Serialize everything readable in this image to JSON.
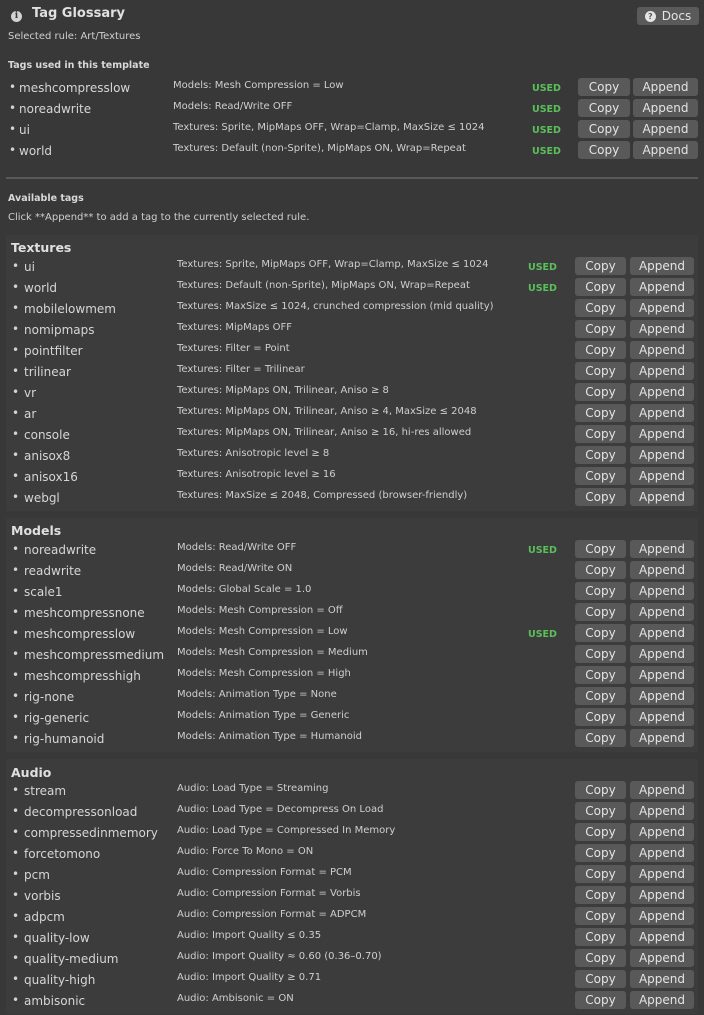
{
  "header": {
    "title": "Tag Glossary",
    "docs_label": "Docs",
    "selected_rule": "Selected rule: Art/Textures"
  },
  "template": {
    "heading": "Tags used in this template",
    "tags": [
      {
        "name": "meshcompresslow",
        "desc": "Models: Mesh Compression = Low",
        "used": "USED"
      },
      {
        "name": "noreadwrite",
        "desc": "Models: Read/Write OFF",
        "used": "USED"
      },
      {
        "name": "ui",
        "desc": "Textures: Sprite, MipMaps OFF, Wrap=Clamp, MaxSize ≤ 1024",
        "used": "USED"
      },
      {
        "name": "world",
        "desc": "Textures: Default (non-Sprite), MipMaps ON, Wrap=Repeat",
        "used": "USED"
      }
    ]
  },
  "available": {
    "heading": "Available tags",
    "hint": "Click **Append** to add a tag to the currently selected rule."
  },
  "buttons": {
    "copy": "Copy",
    "append": "Append"
  },
  "groups": [
    {
      "title": "Textures",
      "tags": [
        {
          "name": "ui",
          "desc": "Textures: Sprite, MipMaps OFF, Wrap=Clamp, MaxSize ≤ 1024",
          "used": "USED"
        },
        {
          "name": "world",
          "desc": "Textures: Default (non-Sprite), MipMaps ON, Wrap=Repeat",
          "used": "USED"
        },
        {
          "name": "mobilelowmem",
          "desc": "Textures: MaxSize ≤ 1024, crunched compression (mid quality)",
          "used": ""
        },
        {
          "name": "nomipmaps",
          "desc": "Textures: MipMaps OFF",
          "used": ""
        },
        {
          "name": "pointfilter",
          "desc": "Textures: Filter = Point",
          "used": ""
        },
        {
          "name": "trilinear",
          "desc": "Textures: Filter = Trilinear",
          "used": ""
        },
        {
          "name": "vr",
          "desc": "Textures: MipMaps ON, Trilinear, Aniso ≥ 8",
          "used": ""
        },
        {
          "name": "ar",
          "desc": "Textures: MipMaps ON, Trilinear, Aniso ≥ 4, MaxSize ≤ 2048",
          "used": ""
        },
        {
          "name": "console",
          "desc": "Textures: MipMaps ON, Trilinear, Aniso ≥ 16, hi-res allowed",
          "used": ""
        },
        {
          "name": "anisox8",
          "desc": "Textures: Anisotropic level ≥ 8",
          "used": ""
        },
        {
          "name": "anisox16",
          "desc": "Textures: Anisotropic level ≥ 16",
          "used": ""
        },
        {
          "name": "webgl",
          "desc": "Textures: MaxSize ≤ 2048, Compressed (browser-friendly)",
          "used": ""
        }
      ]
    },
    {
      "title": "Models",
      "tags": [
        {
          "name": "noreadwrite",
          "desc": "Models: Read/Write OFF",
          "used": "USED"
        },
        {
          "name": "readwrite",
          "desc": "Models: Read/Write ON",
          "used": ""
        },
        {
          "name": "scale1",
          "desc": "Models: Global Scale = 1.0",
          "used": ""
        },
        {
          "name": "meshcompressnone",
          "desc": "Models: Mesh Compression = Off",
          "used": ""
        },
        {
          "name": "meshcompresslow",
          "desc": "Models: Mesh Compression = Low",
          "used": "USED"
        },
        {
          "name": "meshcompressmedium",
          "desc": "Models: Mesh Compression = Medium",
          "used": ""
        },
        {
          "name": "meshcompresshigh",
          "desc": "Models: Mesh Compression = High",
          "used": ""
        },
        {
          "name": "rig-none",
          "desc": "Models: Animation Type = None",
          "used": ""
        },
        {
          "name": "rig-generic",
          "desc": "Models: Animation Type = Generic",
          "used": ""
        },
        {
          "name": "rig-humanoid",
          "desc": "Models: Animation Type = Humanoid",
          "used": ""
        }
      ]
    },
    {
      "title": "Audio",
      "tags": [
        {
          "name": "stream",
          "desc": "Audio: Load Type = Streaming",
          "used": ""
        },
        {
          "name": "decompressonload",
          "desc": "Audio: Load Type = Decompress On Load",
          "used": ""
        },
        {
          "name": "compressedinmemory",
          "desc": "Audio: Load Type = Compressed In Memory",
          "used": ""
        },
        {
          "name": "forcetomono",
          "desc": "Audio: Force To Mono = ON",
          "used": ""
        },
        {
          "name": "pcm",
          "desc": "Audio: Compression Format = PCM",
          "used": ""
        },
        {
          "name": "vorbis",
          "desc": "Audio: Compression Format = Vorbis",
          "used": ""
        },
        {
          "name": "adpcm",
          "desc": "Audio: Compression Format = ADPCM",
          "used": ""
        },
        {
          "name": "quality-low",
          "desc": "Audio: Import Quality ≤ 0.35",
          "used": ""
        },
        {
          "name": "quality-medium",
          "desc": "Audio: Import Quality ≈ 0.60 (0.36–0.70)",
          "used": ""
        },
        {
          "name": "quality-high",
          "desc": "Audio: Import Quality ≥ 0.71",
          "used": ""
        },
        {
          "name": "ambisonic",
          "desc": "Audio: Ambisonic = ON",
          "used": ""
        }
      ]
    }
  ]
}
